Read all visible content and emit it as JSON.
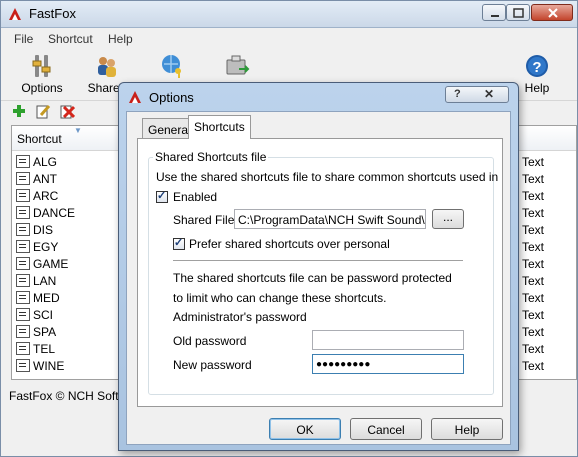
{
  "main_window": {
    "title": "FastFox",
    "menu": [
      "File",
      "Shortcut",
      "Help"
    ],
    "toolbar": [
      {
        "label": "Options",
        "icon": "options-icon"
      },
      {
        "label": "Shared",
        "icon": "shared-icon"
      },
      {
        "label": "",
        "icon": "globe-key-icon"
      },
      {
        "label": "",
        "icon": "export-icon"
      },
      {
        "label": "Help",
        "icon": "help-icon"
      }
    ],
    "mini_toolbar": [
      "add-icon",
      "edit-icon",
      "delete-icon"
    ],
    "list": {
      "column_header": "Shortcut",
      "column_header_2": "",
      "rows": [
        {
          "name": "ALG",
          "type": "Text"
        },
        {
          "name": "ANT",
          "type": "Text"
        },
        {
          "name": "ARC",
          "type": "Text"
        },
        {
          "name": "DANCE",
          "type": "Text"
        },
        {
          "name": "DIS",
          "type": "Text"
        },
        {
          "name": "EGY",
          "type": "Text"
        },
        {
          "name": "GAME",
          "type": "Text"
        },
        {
          "name": "LAN",
          "type": "Text"
        },
        {
          "name": "MED",
          "type": "Text"
        },
        {
          "name": "SCI",
          "type": "Text"
        },
        {
          "name": "SPA",
          "type": "Text"
        },
        {
          "name": "TEL",
          "type": "Text"
        },
        {
          "name": "WINE",
          "type": "Text"
        }
      ]
    },
    "status": "FastFox © NCH Softw"
  },
  "dialog": {
    "title": "Options",
    "tabs": [
      "General",
      "Shortcuts"
    ],
    "active_tab": "Shortcuts",
    "group_title": "Shared Shortcuts file",
    "description": "Use the shared shortcuts file to share common shortcuts used in",
    "enabled_label": "Enabled",
    "enabled_checked": true,
    "shared_file_label": "Shared File",
    "shared_file_value": "C:\\ProgramData\\NCH Swift Sound\\Fas",
    "browse_label": "...",
    "prefer_label": "Prefer shared shortcuts over personal",
    "prefer_checked": true,
    "pw_note_1": "The shared shortcuts file can be password protected",
    "pw_note_2": "to limit who can change these shortcuts.",
    "admin_pw_label": "Administrator's password",
    "old_pw_label": "Old password",
    "old_pw_value": "",
    "new_pw_label": "New password",
    "new_pw_value": "●●●●●●●●●",
    "buttons": {
      "ok": "OK",
      "cancel": "Cancel",
      "help": "Help"
    }
  },
  "colors": {
    "title_gradient_top": "#e3ecf6",
    "dialog_frame": "#a9c3e0",
    "default_button_border": "#3c7fb1"
  }
}
